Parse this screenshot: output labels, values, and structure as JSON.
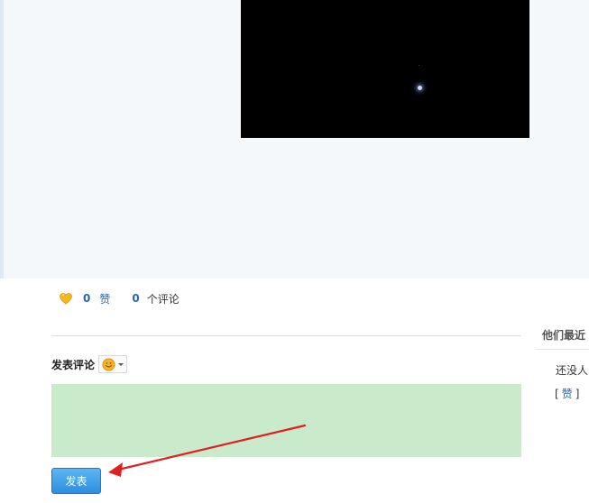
{
  "post": {
    "likes_count": "0",
    "like_label": "赞",
    "comments_count": "0",
    "comments_label": "个评论"
  },
  "comment_form": {
    "title": "发表评论",
    "input_value": "",
    "submit_label": "发表"
  },
  "sidebar": {
    "title": "他们最近",
    "empty_text": "还没人",
    "bracket_open": "[",
    "like_label": "赞",
    "bracket_close": "]"
  },
  "colors": {
    "accent_blue": "#2b64b2",
    "input_bg": "#c9ebcb",
    "button_bg": "#3a9be8",
    "annotation": "#e02020"
  },
  "icons": {
    "like": "heart-icon",
    "emoji": "smiley-icon",
    "dropdown": "caret-down-icon"
  }
}
